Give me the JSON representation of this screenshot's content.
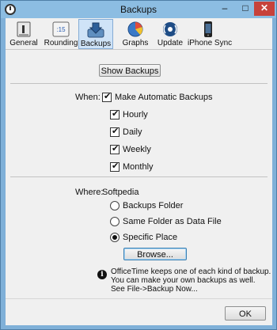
{
  "window": {
    "title": "Backups"
  },
  "toolbar": {
    "items": [
      {
        "label": "General",
        "icon": "general-icon",
        "selected": false
      },
      {
        "label": "Rounding",
        "icon": "rounding-clock-icon",
        "selected": false
      },
      {
        "label": "Backups",
        "icon": "backups-download-icon",
        "selected": true
      },
      {
        "label": "Graphs",
        "icon": "graphs-pie-icon",
        "selected": false
      },
      {
        "label": "Update",
        "icon": "update-broadcast-icon",
        "selected": false
      },
      {
        "label": "iPhone Sync",
        "icon": "iphone-icon",
        "selected": false
      }
    ],
    "rounding_icon_text": ":15"
  },
  "show_backups_label": "Show Backups",
  "when": {
    "label": "When:",
    "auto": {
      "label": "Make Automatic Backups",
      "checked": true
    },
    "options": [
      {
        "label": "Hourly",
        "checked": true
      },
      {
        "label": "Daily",
        "checked": true
      },
      {
        "label": "Weekly",
        "checked": true
      },
      {
        "label": "Monthly",
        "checked": true
      }
    ]
  },
  "where": {
    "label": "Where:",
    "value": "Softpedia",
    "options": [
      {
        "label": "Backups Folder",
        "selected": false
      },
      {
        "label": "Same Folder as Data File",
        "selected": false
      },
      {
        "label": "Specific Place",
        "selected": true
      }
    ],
    "browse_label": "Browse..."
  },
  "info": {
    "lines": [
      "OfficeTime keeps one of each kind of backup.",
      "You can make your own backups as well.",
      "See File->Backup Now..."
    ]
  },
  "ok_label": "OK"
}
